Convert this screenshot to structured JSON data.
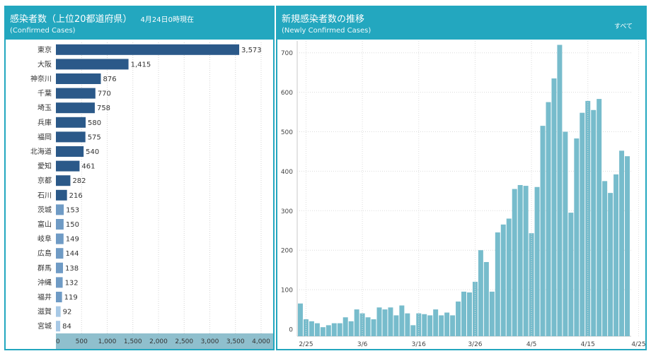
{
  "left_panel": {
    "title": "感染者数（上位20都道府県）",
    "date": "4月24日0時現在",
    "subtitle": "(Confirmed Cases)"
  },
  "right_panel": {
    "title": "新規感染者数の推移",
    "subtitle": "(Newly Confirmed Cases)",
    "filter_label": "すべて"
  },
  "colors": {
    "header": "#23a7bf",
    "bar_teal": "#77bccc",
    "axis_band": "#8fbfcd"
  },
  "chart_data": [
    {
      "type": "bar",
      "orientation": "horizontal",
      "categories": [
        "東京",
        "大阪",
        "神奈川",
        "千葉",
        "埼玉",
        "兵庫",
        "福岡",
        "北海道",
        "愛知",
        "京都",
        "石川",
        "茨城",
        "富山",
        "岐阜",
        "広島",
        "群馬",
        "沖縄",
        "福井",
        "滋賀",
        "宮城"
      ],
      "values": [
        3573,
        1415,
        876,
        770,
        758,
        580,
        575,
        540,
        461,
        282,
        216,
        153,
        150,
        149,
        144,
        138,
        132,
        119,
        92,
        84
      ],
      "value_labels": [
        "3,573",
        "1,415",
        "876",
        "770",
        "758",
        "580",
        "575",
        "540",
        "461",
        "282",
        "216",
        "153",
        "150",
        "149",
        "144",
        "138",
        "132",
        "119",
        "92",
        "84"
      ],
      "xlim": [
        0,
        4000
      ],
      "xticks": [
        "0",
        "500",
        "1,000",
        "1,500",
        "2,000",
        "2,500",
        "3,000",
        "3,500",
        "4,000"
      ],
      "bar_colors": [
        "#2b5989",
        "#2b5989",
        "#2b5989",
        "#2b5989",
        "#2b5989",
        "#2b5989",
        "#2b5989",
        "#2b5989",
        "#2b5989",
        "#2b5989",
        "#2b5989",
        "#6f9bc5",
        "#6f9bc5",
        "#6f9bc5",
        "#6f9bc5",
        "#6f9bc5",
        "#6f9bc5",
        "#6f9bc5",
        "#a8c9e6",
        "#a8c9e6"
      ],
      "grid": true
    },
    {
      "type": "bar",
      "x": [
        "2/24",
        "2/25",
        "2/26",
        "2/27",
        "2/28",
        "2/29",
        "3/1",
        "3/2",
        "3/3",
        "3/4",
        "3/5",
        "3/6",
        "3/7",
        "3/8",
        "3/9",
        "3/10",
        "3/11",
        "3/12",
        "3/13",
        "3/14",
        "3/15",
        "3/16",
        "3/17",
        "3/18",
        "3/19",
        "3/20",
        "3/21",
        "3/22",
        "3/23",
        "3/24",
        "3/25",
        "3/26",
        "3/27",
        "3/28",
        "3/29",
        "3/30",
        "3/31",
        "4/1",
        "4/2",
        "4/3",
        "4/4",
        "4/5",
        "4/6",
        "4/7",
        "4/8",
        "4/9",
        "4/10",
        "4/11",
        "4/12",
        "4/13",
        "4/14",
        "4/15",
        "4/16",
        "4/17",
        "4/18",
        "4/19",
        "4/20",
        "4/21",
        "4/22",
        "4/23"
      ],
      "values": [
        65,
        25,
        20,
        15,
        5,
        10,
        15,
        15,
        30,
        20,
        50,
        40,
        30,
        25,
        55,
        50,
        55,
        35,
        60,
        40,
        10,
        40,
        38,
        35,
        50,
        35,
        42,
        35,
        70,
        95,
        93,
        120,
        200,
        170,
        95,
        245,
        265,
        280,
        355,
        365,
        363,
        243,
        360,
        515,
        575,
        635,
        720,
        500,
        295,
        483,
        548,
        578,
        555,
        583,
        375,
        345,
        392,
        452,
        438
      ],
      "xticks": [
        "2/25",
        "3/6",
        "3/16",
        "3/26",
        "4/5",
        "4/15",
        "4/25"
      ],
      "ylim": [
        0,
        750
      ],
      "yticks": [
        0,
        100,
        200,
        300,
        400,
        500,
        600,
        700
      ],
      "grid": true
    }
  ]
}
